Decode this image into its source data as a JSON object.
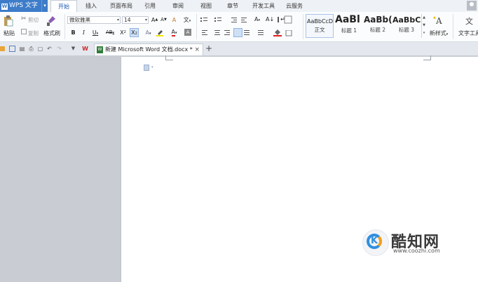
{
  "app": {
    "name": "WPS 文字",
    "logo_letter": "W",
    "dropdown": "▾"
  },
  "menu_tabs": [
    "开始",
    "插入",
    "页面布局",
    "引用",
    "审阅",
    "视图",
    "章节",
    "开发工具",
    "云服务"
  ],
  "clipboard": {
    "paste": "粘贴",
    "cut": "剪切",
    "copy": "复制",
    "format_painter": "格式刷"
  },
  "font": {
    "family": "微软雅黑",
    "size": "14"
  },
  "styles": [
    {
      "sample": "AaBbCcDd",
      "label": "正文"
    },
    {
      "sample": "AaBl",
      "label": "标题 1"
    },
    {
      "sample": "AaBb(",
      "label": "标题 2"
    },
    {
      "sample": "AaBbC",
      "label": "标题 3"
    }
  ],
  "new_style": "新样式",
  "text_tools": "文字工具",
  "document": {
    "tab_title": "新建 Microsoft Word 文档.docx *",
    "close": "×",
    "add": "+"
  },
  "watermark": {
    "title": "酷知网",
    "url": "www.coozhi.com"
  },
  "colors": {
    "accent": "#3d7cc9",
    "active_tab_text": "#1a56b0"
  }
}
